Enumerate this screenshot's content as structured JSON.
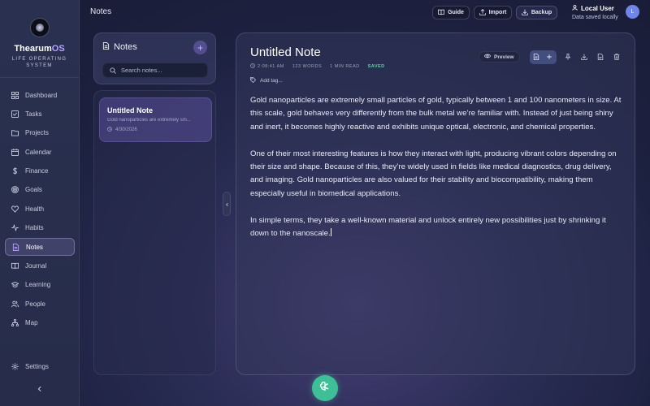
{
  "app": {
    "brand_name_main": "Thearum",
    "brand_name_accent": "OS",
    "brand_subtitle_1": "LIFE OPERATING",
    "brand_subtitle_2": "SYSTEM"
  },
  "sidebar": {
    "items": [
      {
        "label": "Dashboard",
        "icon": "grid-icon",
        "active": false
      },
      {
        "label": "Tasks",
        "icon": "checkbox-icon",
        "active": false
      },
      {
        "label": "Projects",
        "icon": "folder-icon",
        "active": false
      },
      {
        "label": "Calendar",
        "icon": "calendar-icon",
        "active": false
      },
      {
        "label": "Finance",
        "icon": "dollar-icon",
        "active": false
      },
      {
        "label": "Goals",
        "icon": "target-icon",
        "active": false
      },
      {
        "label": "Health",
        "icon": "heart-icon",
        "active": false
      },
      {
        "label": "Habits",
        "icon": "pulse-icon",
        "active": false
      },
      {
        "label": "Notes",
        "icon": "document-icon",
        "active": true
      },
      {
        "label": "Journal",
        "icon": "book-icon",
        "active": false
      },
      {
        "label": "Learning",
        "icon": "graduation-cap-icon",
        "active": false
      },
      {
        "label": "People",
        "icon": "users-icon",
        "active": false
      },
      {
        "label": "Map",
        "icon": "sitemap-icon",
        "active": false
      }
    ],
    "settings_label": "Settings"
  },
  "topbar": {
    "page_title": "Notes",
    "guide_label": "Guide",
    "import_label": "Import",
    "backup_label": "Backup",
    "user_name": "Local User",
    "user_status": "Data saved locally",
    "avatar_initial": "L"
  },
  "notes_panel": {
    "title": "Notes",
    "search_placeholder": "Search notes..."
  },
  "notes_list": [
    {
      "title": "Untitled Note",
      "preview": "Gold nanoparticles are extremely sm...",
      "date": "4/30/2026"
    }
  ],
  "editor": {
    "title": "Untitled Note",
    "time": "2:08:41 AM",
    "words": "123 WORDS",
    "read_time": "1 MIN READ",
    "status": "SAVED",
    "add_tag_label": "Add tag...",
    "preview_label": "Preview",
    "paragraphs": [
      "Gold nanoparticles are extremely small particles of gold, typically between 1 and 100 nanometers in size. At this scale, gold behaves very differently from the bulk metal we’re familiar with. Instead of just being shiny and inert, it becomes highly reactive and exhibits unique optical, electronic, and chemical properties.",
      "One of their most interesting features is how they interact with light, producing vibrant colors depending on their size and shape. Because of this, they’re widely used in fields like medical diagnostics, drug delivery, and imaging. Gold nanoparticles are also valued for their stability and biocompatibility, making them especially useful in biomedical applications.",
      "In simple terms, they take a well-known material and unlock entirely new possibilities just by shrinking it down to the nanoscale."
    ]
  },
  "colors": {
    "accent": "#b8a3ff",
    "saved": "#5dd2a0",
    "fab": "#3fbf98",
    "avatar": "#6f86e8"
  }
}
